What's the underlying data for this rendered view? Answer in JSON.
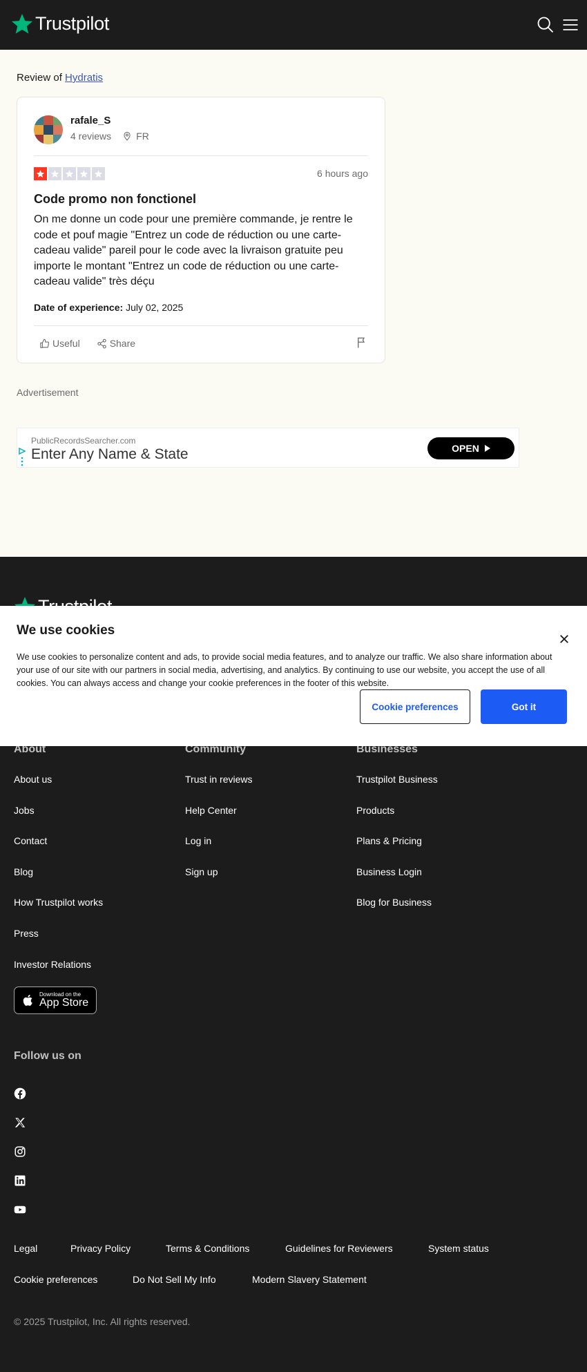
{
  "header": {
    "brand": "Trustpilot",
    "search_icon": "search-icon",
    "menu_icon": "menu-icon",
    "brand_color": "#00b67a"
  },
  "review_of": {
    "prefix": "Review of",
    "company": "Hydratis"
  },
  "review": {
    "reviewer_name": "rafale_S",
    "review_count": "4 reviews",
    "country": "FR",
    "rating": 1,
    "max_rating": 5,
    "time_ago": "6 hours ago",
    "title": "Code promo non fonctionel",
    "body": "On me donne un code pour une première commande, je rentre le code et pouf magie \"Entrez un code de réduction ou une carte-cadeau valide\" pareil pour le code avec la livraison gratuite peu importe le montant \"Entrez un code de réduction ou une carte-cadeau valide\" très déçu",
    "experience_label": "Date of experience:",
    "experience_date": "July 02, 2025",
    "useful_label": "Useful",
    "share_label": "Share",
    "star_color": "#ff3722"
  },
  "ad": {
    "label": "Advertisement",
    "source": "PublicRecordsSearcher.com",
    "headline": "Enter Any Name & State",
    "cta": "OPEN"
  },
  "cookie": {
    "title": "We use cookies",
    "text": "We use cookies to personalize content and ads, to provide social media features, and to analyze our traffic. We also share information about your use of our site with our partners in social media, advertising, and analytics. By continuing to use our website, you accept the use of all cookies. You can always access and change your cookie preferences in the footer of this website.",
    "prefs_button": "Cookie preferences",
    "accept_button": "Got it",
    "accent": "#1c5cf5"
  },
  "footer": {
    "columns": [
      {
        "heading": "About",
        "links": [
          "About us",
          "Jobs",
          "Contact",
          "Blog",
          "How Trustpilot works",
          "Press",
          "Investor Relations"
        ]
      },
      {
        "heading": "Community",
        "links": [
          "Trust in reviews",
          "Help Center",
          "Log in",
          "Sign up"
        ]
      },
      {
        "heading": "Businesses",
        "links": [
          "Trustpilot Business",
          "Products",
          "Plans & Pricing",
          "Business Login",
          "Blog for Business"
        ]
      }
    ],
    "appstore_small": "Download on the",
    "appstore_big": "App Store",
    "follow_label": "Follow us on",
    "social": [
      "facebook-icon",
      "x-icon",
      "instagram-icon",
      "linkedin-icon",
      "youtube-icon"
    ],
    "legal_links_row1": [
      "Legal",
      "Privacy Policy",
      "Terms & Conditions",
      "Guidelines for Reviewers",
      "System status"
    ],
    "legal_links_row2": [
      "Cookie preferences",
      "Do Not Sell My Info",
      "Modern Slavery Statement"
    ],
    "copyright": "© 2025 Trustpilot, Inc. All rights reserved."
  }
}
